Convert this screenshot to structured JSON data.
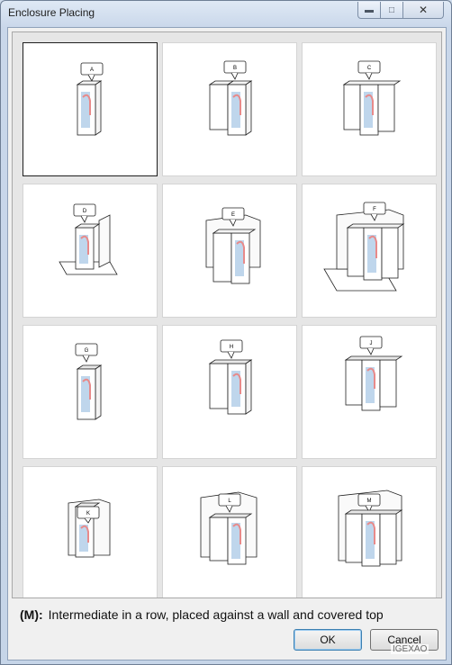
{
  "window": {
    "title": "Enclosure Placing",
    "minimize_icon": "minimize-icon",
    "maximize_icon": "maximize-icon",
    "close_icon": "close-icon"
  },
  "tiles": [
    {
      "label": "A",
      "selected": true
    },
    {
      "label": "B",
      "selected": false
    },
    {
      "label": "C",
      "selected": false
    },
    {
      "label": "D",
      "selected": false
    },
    {
      "label": "E",
      "selected": false
    },
    {
      "label": "F",
      "selected": false
    },
    {
      "label": "G",
      "selected": false
    },
    {
      "label": "H",
      "selected": false
    },
    {
      "label": "J",
      "selected": false
    },
    {
      "label": "K",
      "selected": false
    },
    {
      "label": "L",
      "selected": false
    },
    {
      "label": "M",
      "selected": false
    }
  ],
  "description": {
    "code": "(M):",
    "text": "Intermediate in a row, placed against a wall and covered top"
  },
  "buttons": {
    "ok": "OK",
    "cancel": "Cancel"
  },
  "watermark": "IGEXAO"
}
